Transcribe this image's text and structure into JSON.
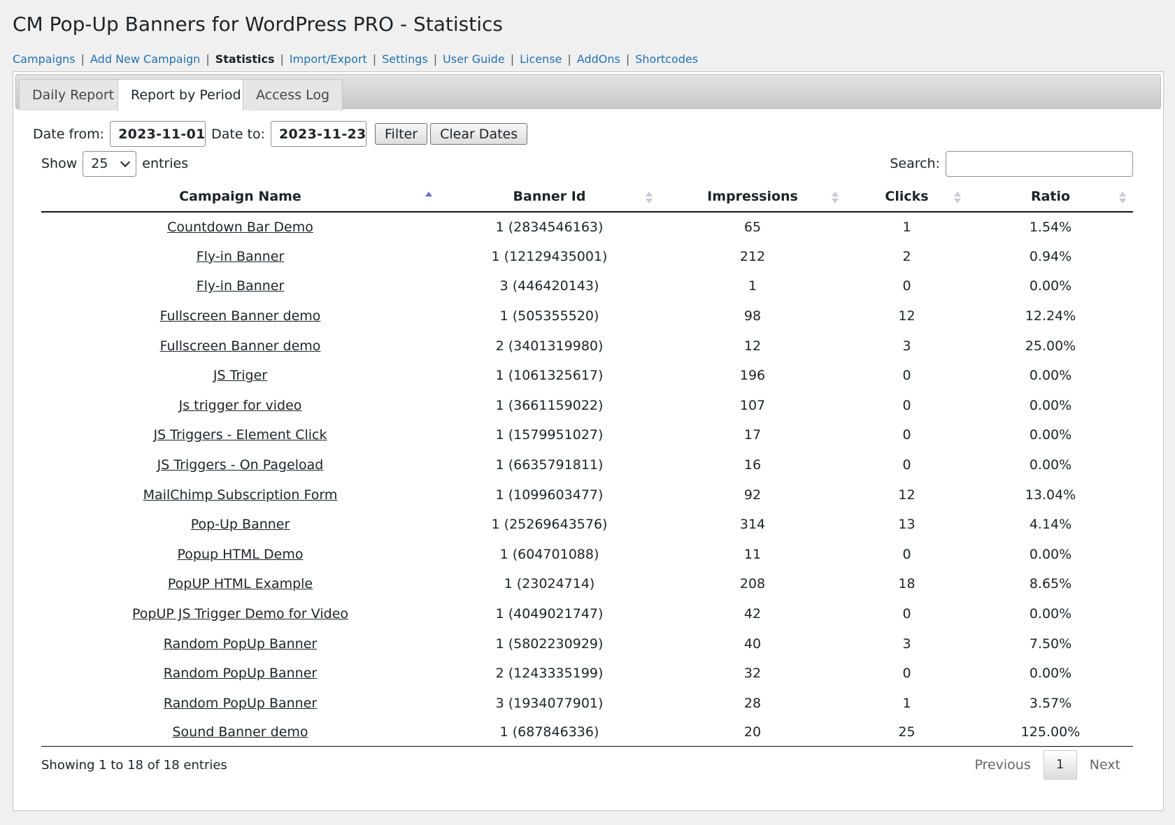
{
  "page": {
    "title": "CM Pop-Up Banners for WordPress PRO - Statistics"
  },
  "subnav": [
    {
      "label": "Campaigns",
      "current": false
    },
    {
      "label": "Add New Campaign",
      "current": false
    },
    {
      "label": "Statistics",
      "current": true
    },
    {
      "label": "Import/Export",
      "current": false
    },
    {
      "label": "Settings",
      "current": false
    },
    {
      "label": "User Guide",
      "current": false
    },
    {
      "label": "License",
      "current": false
    },
    {
      "label": "AddOns",
      "current": false
    },
    {
      "label": "Shortcodes",
      "current": false
    }
  ],
  "tabs": [
    {
      "label": "Daily Report",
      "active": false
    },
    {
      "label": "Report by Period",
      "active": true
    },
    {
      "label": "Access Log",
      "active": false
    }
  ],
  "filter": {
    "date_from_label": "Date from:",
    "date_from_value": "2023-11-01",
    "date_to_label": "Date to:",
    "date_to_value": "2023-11-23",
    "filter_button": "Filter",
    "clear_button": "Clear Dates"
  },
  "table_controls": {
    "show_label": "Show",
    "entries_value": "25",
    "entries_label": "entries",
    "search_label": "Search:",
    "search_value": ""
  },
  "table": {
    "columns": [
      "Campaign Name",
      "Banner Id",
      "Impressions",
      "Clicks",
      "Ratio"
    ],
    "sorted_column": 0,
    "rows": [
      [
        "Countdown Bar Demo",
        "1 (2834546163)",
        "65",
        "1",
        "1.54%"
      ],
      [
        "Fly-in Banner",
        "1 (12129435001)",
        "212",
        "2",
        "0.94%"
      ],
      [
        "Fly-in Banner",
        "3 (446420143)",
        "1",
        "0",
        "0.00%"
      ],
      [
        "Fullscreen Banner demo",
        "1 (505355520)",
        "98",
        "12",
        "12.24%"
      ],
      [
        "Fullscreen Banner demo",
        "2 (3401319980)",
        "12",
        "3",
        "25.00%"
      ],
      [
        "JS Triger",
        "1 (1061325617)",
        "196",
        "0",
        "0.00%"
      ],
      [
        "Js trigger for video",
        "1 (3661159022)",
        "107",
        "0",
        "0.00%"
      ],
      [
        "JS Triggers - Element Click",
        "1 (1579951027)",
        "17",
        "0",
        "0.00%"
      ],
      [
        "JS Triggers - On Pageload",
        "1 (6635791811)",
        "16",
        "0",
        "0.00%"
      ],
      [
        "MailChimp Subscription Form",
        "1 (1099603477)",
        "92",
        "12",
        "13.04%"
      ],
      [
        "Pop-Up Banner",
        "1 (25269643576)",
        "314",
        "13",
        "4.14%"
      ],
      [
        "Popup HTML Demo",
        "1 (604701088)",
        "11",
        "0",
        "0.00%"
      ],
      [
        "PopUP HTML Example",
        "1 (23024714)",
        "208",
        "18",
        "8.65%"
      ],
      [
        "PopUP JS Trigger Demo for Video",
        "1 (4049021747)",
        "42",
        "0",
        "0.00%"
      ],
      [
        "Random PopUp Banner",
        "1 (5802230929)",
        "40",
        "3",
        "7.50%"
      ],
      [
        "Random PopUp Banner",
        "2 (1243335199)",
        "32",
        "0",
        "0.00%"
      ],
      [
        "Random PopUp Banner",
        "3 (1934077901)",
        "28",
        "1",
        "3.57%"
      ],
      [
        "Sound Banner demo",
        "1 (687846336)",
        "20",
        "25",
        "125.00%"
      ]
    ]
  },
  "footer": {
    "info": "Showing 1 to 18 of 18 entries",
    "previous": "Previous",
    "current_page": "1",
    "next": "Next"
  }
}
